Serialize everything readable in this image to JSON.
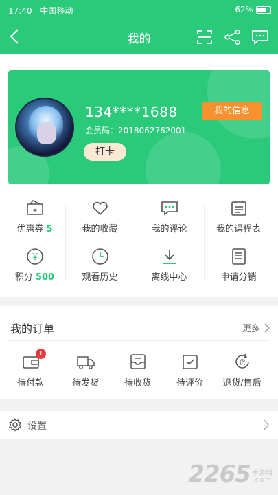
{
  "status_bar": {
    "time": "17:40",
    "carrier": "中国移动",
    "battery": "62%"
  },
  "nav": {
    "title": "我的",
    "back_icon": "chevron-left-icon",
    "scan_icon": "scan-icon",
    "share_icon": "share-icon",
    "message_icon": "message-icon"
  },
  "profile": {
    "phone": "134****1688",
    "member_code": "会员码：2018062762001",
    "checkin_label": "打卡",
    "info_button": "我的信息"
  },
  "grid": [
    {
      "label": "优惠券",
      "value": "5",
      "icon": "coupon-icon"
    },
    {
      "label": "我的收藏",
      "icon": "heart-icon"
    },
    {
      "label": "我的评论",
      "icon": "comment-icon"
    },
    {
      "label": "我的课程表",
      "icon": "calendar-icon"
    },
    {
      "label": "积分",
      "value": "500",
      "icon": "yen-icon"
    },
    {
      "label": "观看历史",
      "icon": "clock-icon"
    },
    {
      "label": "离线中心",
      "icon": "download-icon"
    },
    {
      "label": "申请分销",
      "icon": "document-icon"
    }
  ],
  "orders": {
    "title": "我的订单",
    "more": "更多",
    "items": [
      {
        "label": "待付款",
        "badge": "1",
        "icon": "wallet-icon"
      },
      {
        "label": "待发货",
        "icon": "truck-icon"
      },
      {
        "label": "待收货",
        "icon": "inbox-icon"
      },
      {
        "label": "待评价",
        "icon": "rate-icon"
      },
      {
        "label": "退货/售后",
        "icon": "return-icon"
      }
    ]
  },
  "settings": {
    "label": "设置",
    "icon": "gear-icon"
  },
  "watermark": {
    "number": "2265",
    "suffix": ".com",
    "site": "手游网"
  },
  "colors": {
    "primary": "#2bc97a",
    "accent": "#f5922f",
    "badge": "#e8393d",
    "checkin_bg": "#fbe9d6"
  }
}
